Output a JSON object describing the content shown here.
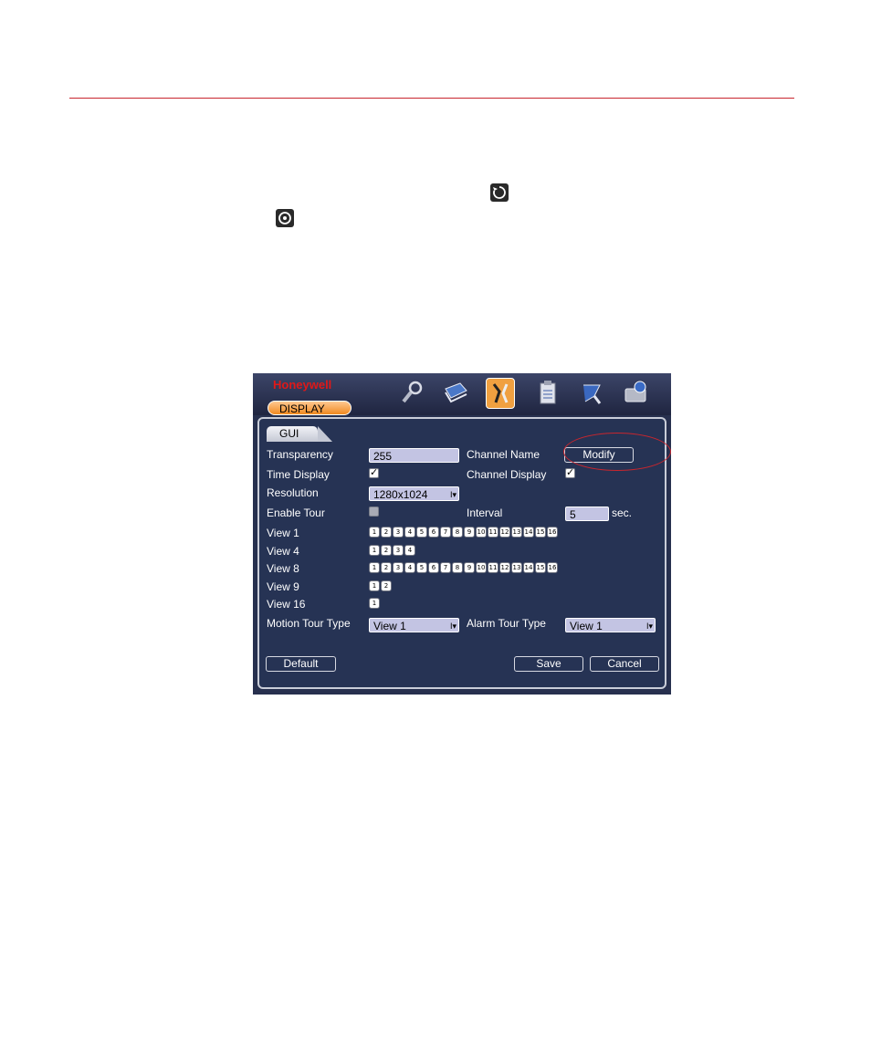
{
  "colors": {
    "rule": "#c8262e",
    "brand": "#e01818",
    "tab_orange": "#f08a20",
    "panel": "#263354",
    "field": "#c3c4e3"
  },
  "header": {
    "brand": "Honeywell",
    "tab": "DISPLAY"
  },
  "top_icons": [
    "search-icon",
    "info-book-icon",
    "tools-icon",
    "clipboard-icon",
    "wizard-icon",
    "disk-icon"
  ],
  "subtab": "GUI",
  "form": {
    "transparency_label": "Transparency",
    "transparency_value": "255",
    "channel_name_label": "Channel Name",
    "modify_button": "Modify",
    "time_display_label": "Time Display",
    "channel_display_label": "Channel Display",
    "resolution_label": "Resolution",
    "resolution_value": "1280x1024",
    "enable_tour_label": "Enable Tour",
    "interval_label": "Interval",
    "interval_value": "5",
    "interval_unit": "sec.",
    "view1_label": "View 1",
    "view4_label": "View 4",
    "view8_label": "View 8",
    "view9_label": "View 9",
    "view16_label": "View 16",
    "motion_tour_label": "Motion Tour Type",
    "motion_tour_value": "View 1",
    "alarm_tour_label": "Alarm Tour Type",
    "alarm_tour_value": "View 1",
    "time_display_checked": true,
    "channel_display_checked": true,
    "enable_tour_checked": false
  },
  "views": {
    "view1": [
      "1",
      "2",
      "3",
      "4",
      "5",
      "6",
      "7",
      "8",
      "9",
      "10",
      "11",
      "12",
      "13",
      "14",
      "15",
      "16"
    ],
    "view4": [
      "1",
      "2",
      "3",
      "4"
    ],
    "view8": [
      "1",
      "2",
      "3",
      "4",
      "5",
      "6",
      "7",
      "8",
      "9",
      "10",
      "11",
      "12",
      "13",
      "14",
      "15",
      "16"
    ],
    "view9": [
      "1",
      "2"
    ],
    "view16": [
      "1"
    ]
  },
  "buttons": {
    "default": "Default",
    "save": "Save",
    "cancel": "Cancel"
  }
}
